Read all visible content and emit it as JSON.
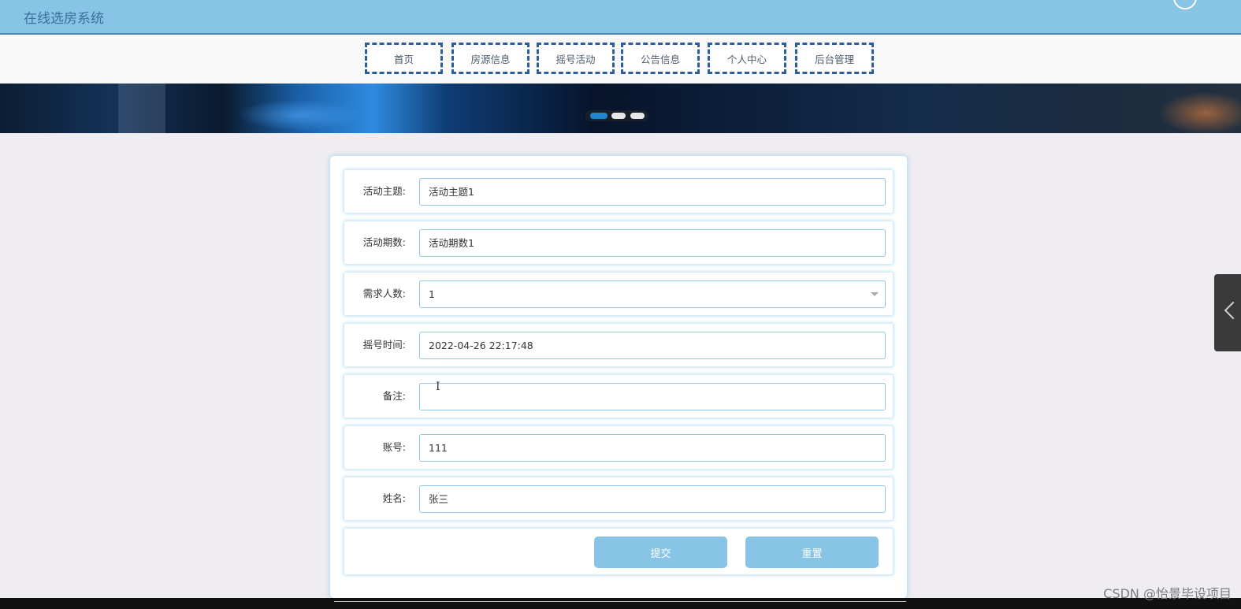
{
  "header": {
    "title": "在线选房系统"
  },
  "nav": {
    "items": [
      "首页",
      "房源信息",
      "摇号活动",
      "公告信息",
      "个人中心",
      "后台管理"
    ]
  },
  "carousel": {
    "slide_count": 3,
    "active_index": 0,
    "colors": {
      "active": "#1f88d0",
      "inactive": "#e8e8e8"
    }
  },
  "form": {
    "fields": [
      {
        "label": "活动主题:",
        "value": "活动主题1"
      },
      {
        "label": "活动期数:",
        "value": "活动期数1"
      },
      {
        "label": "需求人数:",
        "value": "1",
        "type": "select"
      },
      {
        "label": "摇号时间:",
        "value": "2022-04-26 22:17:48"
      },
      {
        "label": "备注:",
        "value": ""
      },
      {
        "label": "账号:",
        "value": "111"
      },
      {
        "label": "姓名:",
        "value": "张三"
      }
    ],
    "submit_label": "提交",
    "reset_label": "重置"
  },
  "icons": {
    "text_cursor": "I",
    "side_toggle": "chevron-left-icon"
  },
  "colors": {
    "header_bg": "#87c4e6",
    "button_bg": "#87c4e6",
    "nav_border": "#2f5d9b"
  },
  "watermark": "CSDN @怡景毕设项目"
}
